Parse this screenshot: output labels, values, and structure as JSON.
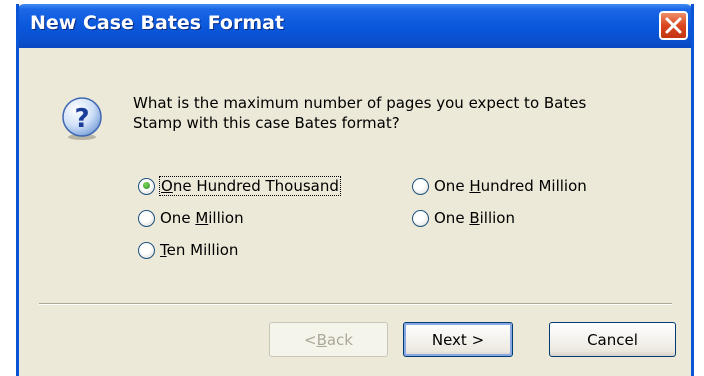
{
  "window": {
    "title": "New Case Bates Format",
    "close_icon": "close-icon"
  },
  "dialog": {
    "icon": "question-icon",
    "prompt_line1": "What is the maximum number of pages you expect to Bates",
    "prompt_line2": "Stamp with this case Bates format?"
  },
  "options": {
    "one_hundred_thousand": {
      "pre": "",
      "key": "O",
      "post": "ne Hundred Thousand",
      "selected": true
    },
    "one_hundred_million": {
      "pre": "One ",
      "key": "H",
      "post": "undred Million",
      "selected": false
    },
    "one_million": {
      "pre": "One ",
      "key": "M",
      "post": "illion",
      "selected": false
    },
    "one_billion": {
      "pre": "One ",
      "key": "B",
      "post": "illion",
      "selected": false
    },
    "ten_million": {
      "pre": "",
      "key": "T",
      "post": "en Million",
      "selected": false
    }
  },
  "buttons": {
    "back": {
      "pre": "< ",
      "key": "B",
      "post": "ack",
      "enabled": false
    },
    "next": {
      "label": "Next >",
      "default": true
    },
    "cancel": {
      "label": "Cancel"
    }
  },
  "colors": {
    "titlebar": "#0a58dc",
    "dialog_bg": "#ece9d8",
    "radio_selected": "#2d8f1c",
    "close_button": "#d9461f"
  }
}
